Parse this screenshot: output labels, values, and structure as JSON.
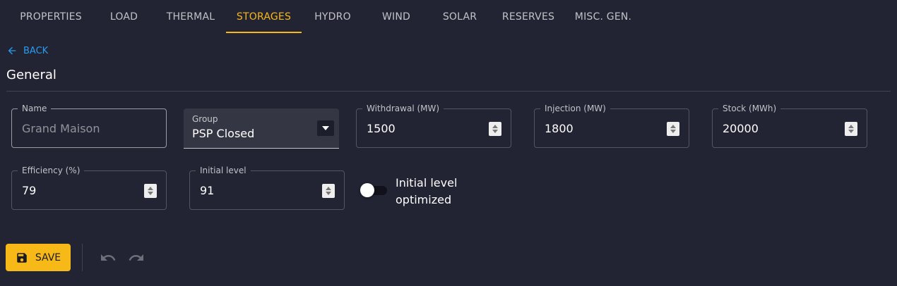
{
  "tabs": [
    {
      "label": "PROPERTIES"
    },
    {
      "label": "LOAD"
    },
    {
      "label": "THERMAL"
    },
    {
      "label": "STORAGES"
    },
    {
      "label": "HYDRO"
    },
    {
      "label": "WIND"
    },
    {
      "label": "SOLAR"
    },
    {
      "label": "RESERVES"
    },
    {
      "label": "MISC. GEN."
    }
  ],
  "active_tab": "STORAGES",
  "back": {
    "label": "BACK"
  },
  "section": {
    "title": "General"
  },
  "fields": {
    "name": {
      "label": "Name",
      "value": "Grand Maison"
    },
    "group": {
      "label": "Group",
      "value": "PSP Closed"
    },
    "withdrawal": {
      "label": "Withdrawal (MW)",
      "value": "1500"
    },
    "injection": {
      "label": "Injection (MW)",
      "value": "1800"
    },
    "stock": {
      "label": "Stock (MWh)",
      "value": "20000"
    },
    "efficiency": {
      "label": "Efficiency (%)",
      "value": "79"
    },
    "initial_level": {
      "label": "Initial level",
      "value": "91"
    }
  },
  "toggle": {
    "label": "Initial level optimized",
    "checked": false
  },
  "actions": {
    "save_label": "SAVE"
  },
  "colors": {
    "accent": "#f7b917",
    "link": "#2a9cf0",
    "background": "#222333"
  },
  "icons": {
    "back": "arrow-left-icon",
    "save": "floppy-disk-icon",
    "undo": "undo-icon",
    "redo": "redo-icon"
  }
}
